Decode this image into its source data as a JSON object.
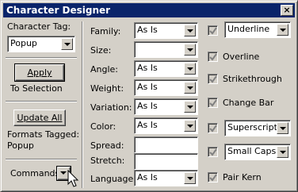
{
  "window": {
    "title": "Character Designer",
    "close_glyph": "×"
  },
  "left": {
    "char_tag_label": "Character Tag:",
    "char_tag_value": "Popup",
    "apply_label": "Apply",
    "to_selection": "To Selection",
    "update_all_label": "Update All",
    "formats_tagged": "Formats Tagged:",
    "formats_tagged_value": "Popup",
    "commands_label": "Commands:"
  },
  "fields": {
    "family": {
      "label": "Family:",
      "value": "As Is"
    },
    "size": {
      "label": "Size:",
      "value": ""
    },
    "angle": {
      "label": "Angle:",
      "value": "As Is"
    },
    "weight": {
      "label": "Weight:",
      "value": "As Is"
    },
    "variation": {
      "label": "Variation:",
      "value": "As Is"
    },
    "color": {
      "label": "Color:",
      "value": "As Is"
    },
    "spread": {
      "label": "Spread:",
      "value": ""
    },
    "stretch": {
      "label": "Stretch:",
      "value": ""
    },
    "language": {
      "label": "Language:",
      "value": "As Is"
    }
  },
  "options": {
    "underline": {
      "value": "Underline"
    },
    "overline": {
      "label": "Overline"
    },
    "strikethrough": {
      "label": "Strikethrough"
    },
    "change_bar": {
      "label": "Change Bar"
    },
    "superscript": {
      "value": "Superscript"
    },
    "small_caps": {
      "value": "Small Caps"
    },
    "pair_kern": {
      "label": "Pair Kern"
    }
  }
}
